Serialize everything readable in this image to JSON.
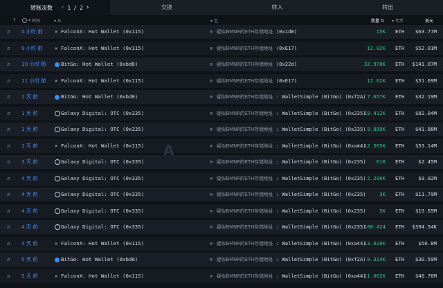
{
  "tabs": {
    "active_label": "转账次数",
    "page_current": "1",
    "page_sep": "/",
    "page_total": "2",
    "prev_arrow": "‹",
    "next_arrow": "›",
    "items": [
      "交换",
      "转入",
      "转出"
    ]
  },
  "header": {
    "arrow": "↑",
    "time": "时间",
    "from": "从",
    "to": "至",
    "amount": "数量",
    "token": "代币",
    "usd": "美元"
  },
  "watermark": "A",
  "rows": [
    {
      "time": "4 小时 前",
      "from_icon": "falcon",
      "from": "FalconX: Hot Wallet (0x115)",
      "to_label": "疑似BMNR的ETH存储地址",
      "to_tail": "(0x1d8)",
      "amount": "15K",
      "token": "ETH",
      "usd": "$63.77M"
    },
    {
      "time": "9 小时 前",
      "from_icon": "falcon",
      "from": "FalconX: Hot Wallet (0x115)",
      "to_label": "疑似BMNR的ETH存储地址",
      "to_tail": "(0xE17)",
      "amount": "12.02K",
      "token": "ETH",
      "usd": "$52.01M"
    },
    {
      "time": "10 小时 前",
      "from_icon": "bitgo",
      "from": "BitGo: Hot Wallet (0xbd0)",
      "to_label": "疑似BMNR的ETH存储地址",
      "to_tail": "(0x22d)",
      "amount": "32.978K",
      "token": "ETH",
      "usd": "$141.07M"
    },
    {
      "time": "11 小时 前",
      "from_icon": "falcon",
      "from": "FalconX: Hot Wallet (0x115)",
      "to_label": "疑似BMNR的ETH存储地址",
      "to_tail": "(0xE17)",
      "amount": "12.02K",
      "token": "ETH",
      "usd": "$51.69M"
    },
    {
      "time": "1 天 前",
      "from_icon": "bitgo",
      "from": "BitGo: Hot Wallet (0xbd0)",
      "to_label": "疑似BMNR的ETH存储地址",
      "to_tail": ": WalletSimple (BitGo) (0xf2A)",
      "amount": "7.657K",
      "token": "ETH",
      "usd": "$32.19M"
    },
    {
      "time": "1 天 前",
      "from_icon": "galaxy",
      "from": "Galaxy Digital: OTC (0x335)",
      "to_label": "疑似BMNR的ETH存储地址",
      "to_tail": ": WalletSimple (BitGo) (0x235)",
      "amount": "19.412K",
      "token": "ETH",
      "usd": "$82.04M"
    },
    {
      "time": "1 天 前",
      "from_icon": "galaxy",
      "from": "Galaxy Digital: OTC (0x335)",
      "to_label": "疑似BMNR的ETH存储地址",
      "to_tail": ": WalletSimple (BitGo) (0x235)",
      "amount": "9.899K",
      "token": "ETH",
      "usd": "$41.88M"
    },
    {
      "time": "1 天 前",
      "from_icon": "falcon",
      "from": "FalconX: Hot Wallet (0x115)",
      "to_label": "疑似BMNR的ETH存储地址",
      "to_tail": ": WalletSimple (BitGo) (0xa44)",
      "amount": "12.565K",
      "token": "ETH",
      "usd": "$53.14M"
    },
    {
      "time": "3 天 前",
      "from_icon": "galaxy",
      "from": "Galaxy Digital: OTC (0x335)",
      "to_label": "疑似BMNR的ETH存储地址",
      "to_tail": ": WalletSimple (BitGo) (0x235)",
      "amount": "618",
      "token": "ETH",
      "usd": "$2.45M"
    },
    {
      "time": "4 天 前",
      "from_icon": "galaxy",
      "from": "Galaxy Digital: OTC (0x335)",
      "to_label": "疑似BMNR的ETH存储地址",
      "to_tail": ": WalletSimple (BitGo) (0x235)",
      "amount": "2.296K",
      "token": "ETH",
      "usd": "$9.02M"
    },
    {
      "time": "4 天 前",
      "from_icon": "galaxy",
      "from": "Galaxy Digital: OTC (0x335)",
      "to_label": "疑似BMNR的ETH存储地址",
      "to_tail": ": WalletSimple (BitGo) (0x235)",
      "amount": "3K",
      "token": "ETH",
      "usd": "$11.79M"
    },
    {
      "time": "4 天 前",
      "from_icon": "galaxy",
      "from": "Galaxy Digital: OTC (0x335)",
      "to_label": "疑似BMNR的ETH存储地址",
      "to_tail": ": WalletSimple (BitGo) (0x235)",
      "amount": "5K",
      "token": "ETH",
      "usd": "$19.65M"
    },
    {
      "time": "4 天 前",
      "from_icon": "galaxy",
      "from": "Galaxy Digital: OTC (0x335)",
      "to_label": "疑似BMNR的ETH存储地址",
      "to_tail": ": WalletSimple (BitGo) (0x235)",
      "amount": "100.424",
      "token": "ETH",
      "usd": "$394.54K"
    },
    {
      "time": "4 天 前",
      "from_icon": "falcon",
      "from": "FalconX: Hot Wallet (0x115)",
      "to_label": "疑似BMNR的ETH存储地址",
      "to_tail": ": WalletSimple (BitGo) (0xa44)",
      "amount": "13.028K",
      "token": "ETH",
      "usd": "$50.8M"
    },
    {
      "time": "5 天 前",
      "from_icon": "bitgo",
      "from": "BitGo: Hot Wallet (0xbd0)",
      "to_label": "疑似BMNR的ETH存储地址",
      "to_tail": ": WalletSimple (BitGo) (0xf2A)",
      "amount": "8.324K",
      "token": "ETH",
      "usd": "$30.59M"
    },
    {
      "time": "5 天 前",
      "from_icon": "falcon",
      "from": "FalconX: Hot Wallet (0x115)",
      "to_label": "疑似BMNR的ETH存储地址",
      "to_tail": ": WalletSimple (BitGo) (0xa44)",
      "amount": "11.062K",
      "token": "ETH",
      "usd": "$40.76M"
    }
  ],
  "colors": {
    "time_link": "#4d8bf2",
    "amount_green": "#32c788",
    "bg": "#0f1318",
    "row_bg": "#1a1f27"
  }
}
